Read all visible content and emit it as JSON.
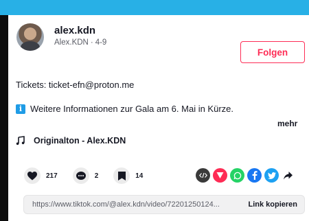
{
  "header": {
    "username": "alex.kdn",
    "display_name": "Alex.KDN",
    "separator": "·",
    "date": "4-9",
    "follow_label": "Folgen"
  },
  "description": {
    "line1": "Tickets: ticket-efn@proton.me",
    "info_icon_glyph": "i",
    "line2": "Weitere Informationen zur Gala am 6. Mai in Kürze.",
    "more_label": "mehr"
  },
  "sound": {
    "label": "Originalton - Alex.KDN"
  },
  "actions": {
    "likes": "217",
    "comments": "2",
    "saves": "14"
  },
  "share": {
    "icons": [
      "embed-icon",
      "send-icon",
      "whatsapp-icon",
      "facebook-icon",
      "twitter-icon",
      "share-arrow-icon"
    ],
    "colors": {
      "embed": "#3a3a3a",
      "send": "#fe2c55",
      "whatsapp": "#25d366",
      "facebook": "#1877f2",
      "twitter": "#1da1f2"
    }
  },
  "link": {
    "url": "https://www.tiktok.com/@alex.kdn/video/72201250124...",
    "copy_label": "Link kopieren"
  },
  "colors": {
    "accent": "#fe2c55",
    "topbar": "#28b0e6"
  }
}
